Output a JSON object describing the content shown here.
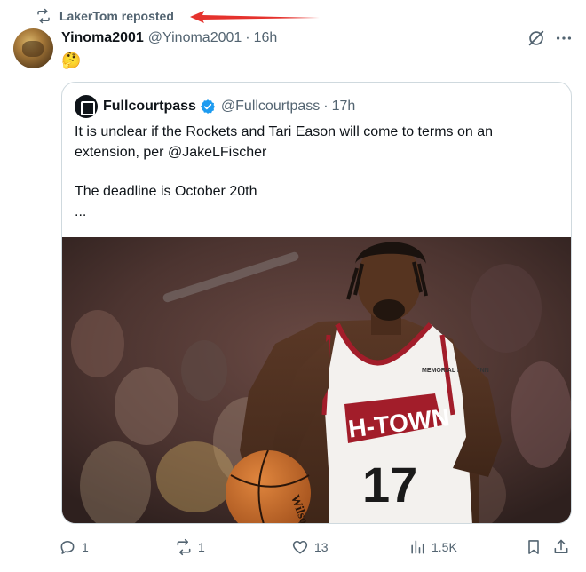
{
  "repost": {
    "label": "LakerTom reposted"
  },
  "tweet": {
    "author_name": "Yinoma2001",
    "author_handle": "@Yinoma2001",
    "separator": "·",
    "time": "16h",
    "text": "🤔"
  },
  "quote": {
    "author_name": "Fullcourtpass",
    "author_handle": "@Fullcourtpass",
    "separator": "·",
    "time": "17h",
    "text_line1": "It is unclear if the Rockets and Tari Eason will come to terms on an extension, per @JakeLFischer",
    "text_line2": "The deadline is October 20th",
    "text_line3": "...",
    "jersey_top": "MEMORIAL HERMANN",
    "jersey_team": "H-TOWN",
    "jersey_number": "17",
    "ball_brand": "Wilson"
  },
  "actions": {
    "replies": "1",
    "reposts": "1",
    "likes": "13",
    "views": "1.5K"
  },
  "colors": {
    "text_primary": "#0f1419",
    "text_secondary": "#536471",
    "verified_blue": "#1d9bf0",
    "annotation_red": "#e5322d",
    "border": "#cfd9de"
  },
  "icons": [
    "repost-icon",
    "grok-icon",
    "more-icon",
    "verified-icon",
    "reply-icon",
    "like-icon",
    "views-icon",
    "bookmark-icon",
    "share-icon"
  ]
}
